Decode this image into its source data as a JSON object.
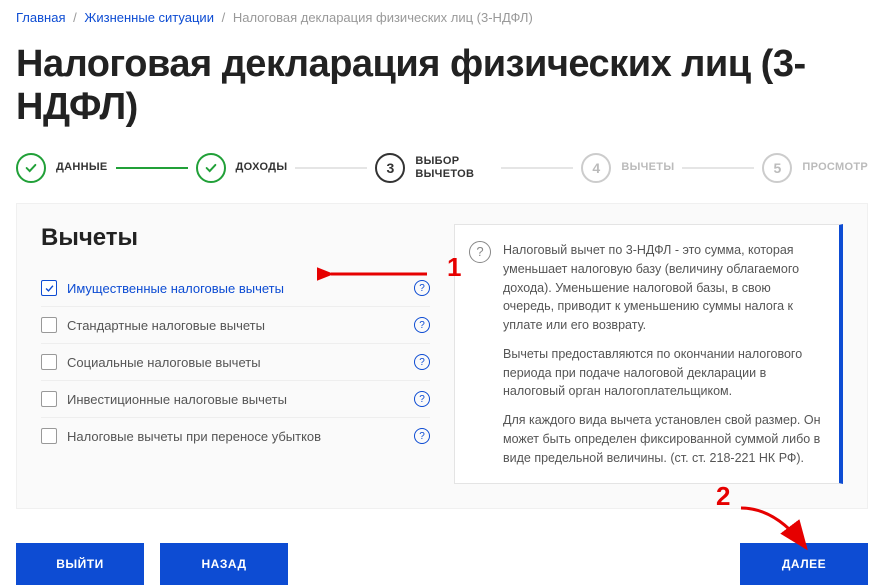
{
  "breadcrumb": {
    "home": "Главная",
    "situations": "Жизненные ситуации",
    "current": "Налоговая декларация физических лиц (3-НДФЛ)"
  },
  "page_title": "Налоговая декларация физических лиц (3-НДФЛ)",
  "stepper": {
    "step1": "ДАННЫЕ",
    "step2": "ДОХОДЫ",
    "step3_num": "3",
    "step3": "ВЫБОР ВЫЧЕТОВ",
    "step4_num": "4",
    "step4": "ВЫЧЕТЫ",
    "step5_num": "5",
    "step5": "ПРОСМОТР"
  },
  "section_title": "Вычеты",
  "checkboxes": {
    "property": "Имущественные налоговые вычеты",
    "standard": "Стандартные налоговые вычеты",
    "social": "Социальные налоговые вычеты",
    "investment": "Инвестиционные налоговые вычеты",
    "loss": "Налоговые вычеты при переносе убытков"
  },
  "info": {
    "p1": "Налоговый вычет по 3-НДФЛ - это сумма, которая уменьшает налоговую базу (величину облагаемого дохода). Уменьшение налоговой базы, в свою очередь, приводит к уменьшению суммы налога к уплате или его возврату.",
    "p2": "Вычеты предоставляются по окончании налогового периода при подаче налоговой декларации в налоговый орган налогоплательщиком.",
    "p3": "Для каждого вида вычета установлен свой размер. Он может быть определен фиксированной суммой либо в виде предельной величины. (ст. ст. 218-221 НК РФ)."
  },
  "buttons": {
    "exit": "ВЫЙТИ",
    "back": "НАЗАД",
    "next": "ДАЛЕЕ"
  },
  "annotations": {
    "one": "1",
    "two": "2"
  }
}
